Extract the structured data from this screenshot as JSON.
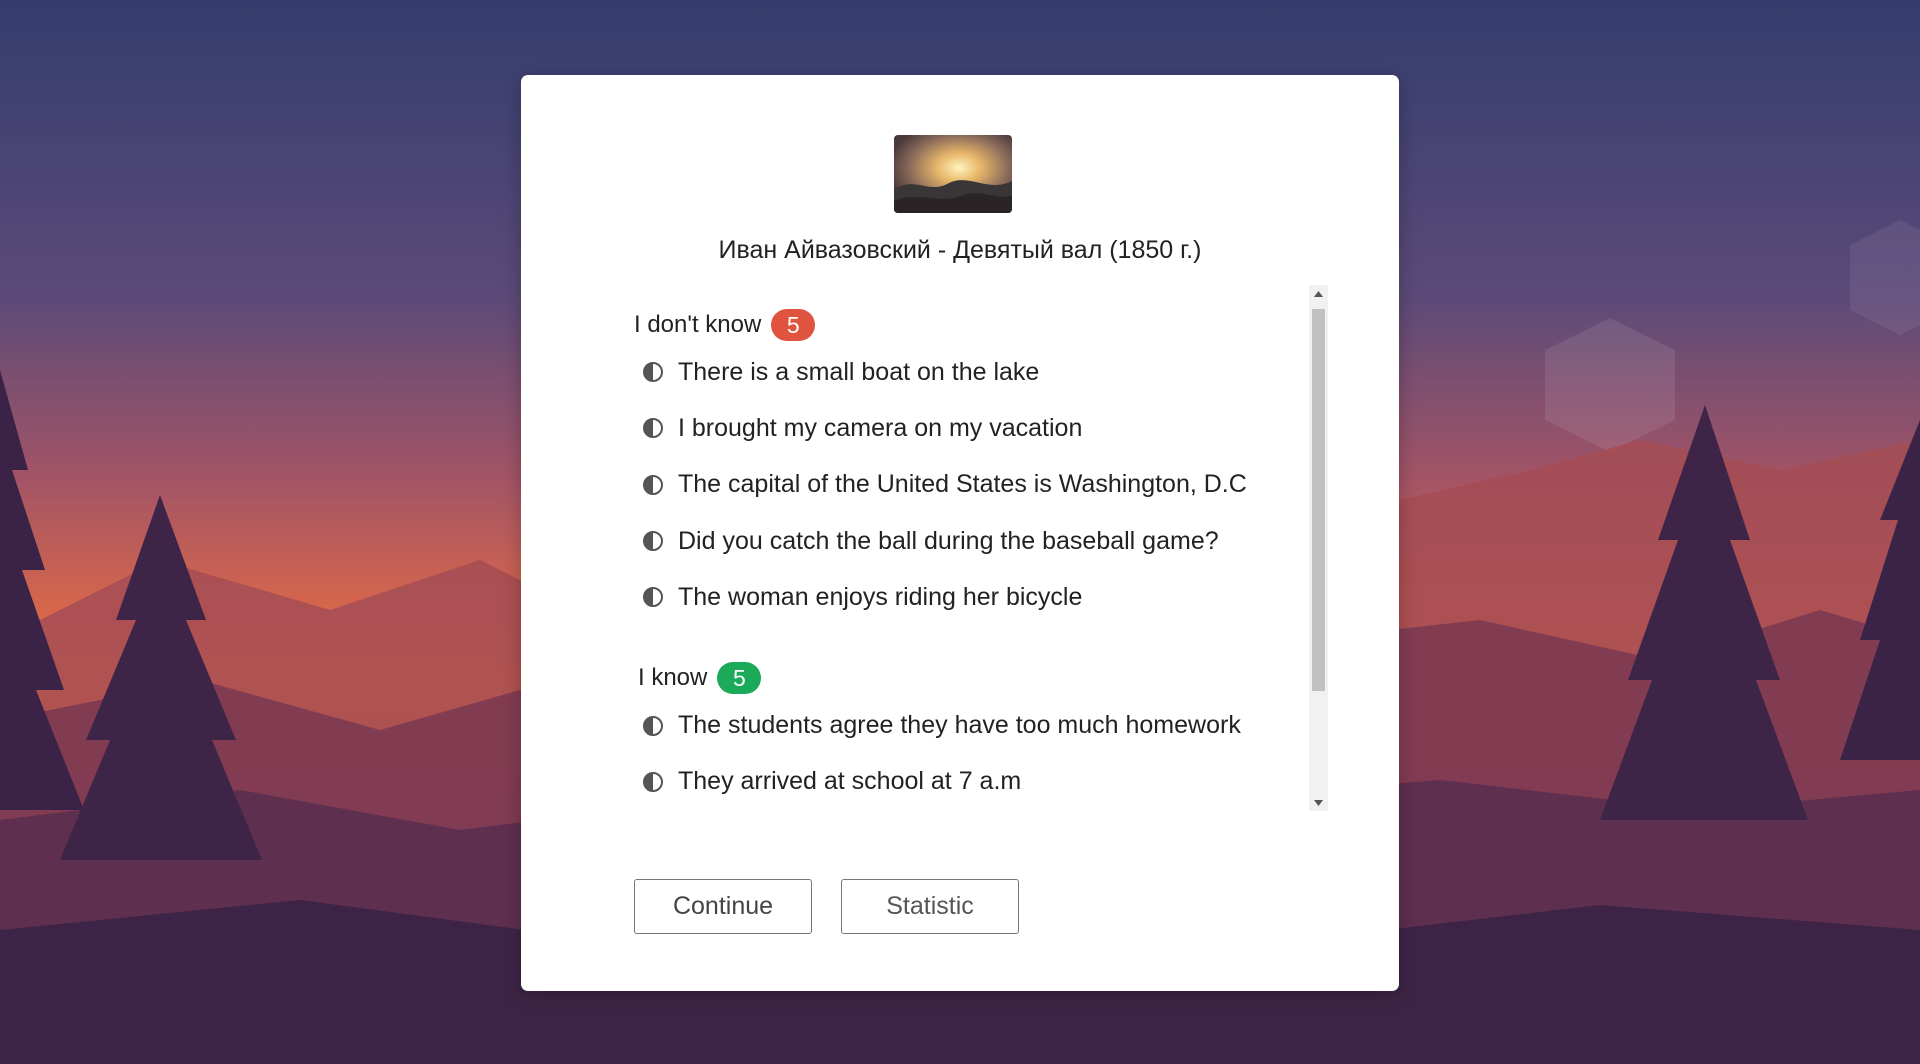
{
  "artwork": {
    "title": "Иван Айвазовский - Девятый вал (1850 г.)"
  },
  "groups": [
    {
      "label": "I don't know",
      "count": "5",
      "badge_color": "#e0533f",
      "items": [
        "There is a small boat on the lake",
        "I brought my camera on my vacation",
        "The capital of the United States is Washington, D.C",
        "Did you catch the ball during the baseball game?",
        "The woman enjoys riding her bicycle"
      ]
    },
    {
      "label": "I know",
      "count": "5",
      "badge_color": "#1aaa5a",
      "items": [
        "The students agree they have too much homework",
        "They arrived at school at 7 a.m"
      ]
    }
  ],
  "icons": {
    "item_icon": "half-circle-contrast-icon",
    "scroll_up": "triangle-up-icon",
    "scroll_down": "triangle-down-icon"
  },
  "buttons": {
    "continue_label": "Continue",
    "statistic_label": "Statistic"
  }
}
